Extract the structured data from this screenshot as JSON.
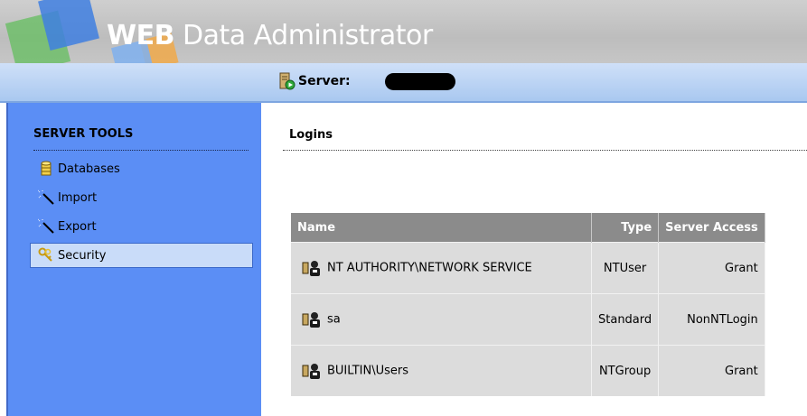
{
  "header": {
    "title_bold": "WEB",
    "title_rest": " Data Administrator"
  },
  "server_bar": {
    "label": "Server:",
    "value_redacted": true
  },
  "sidebar": {
    "heading": "SERVER TOOLS",
    "items": [
      {
        "label": "Databases",
        "icon": "database-icon",
        "selected": false
      },
      {
        "label": "Import",
        "icon": "wand-icon",
        "selected": false
      },
      {
        "label": "Export",
        "icon": "wand-icon",
        "selected": false
      },
      {
        "label": "Security",
        "icon": "keys-icon",
        "selected": true
      }
    ]
  },
  "content": {
    "heading": "Logins",
    "columns": [
      "Name",
      "Type",
      "Server Access"
    ],
    "rows": [
      {
        "name": "NT AUTHORITY\\NETWORK SERVICE",
        "type": "NTUser",
        "access": "Grant",
        "icon": "user-login-icon"
      },
      {
        "name": "sa",
        "type": "Standard",
        "access": "NonNTLogin",
        "icon": "user-login-icon"
      },
      {
        "name": "BUILTIN\\Users",
        "type": "NTGroup",
        "access": "Grant",
        "icon": "user-login-icon"
      }
    ]
  },
  "colors": {
    "sidebar_bg": "#5b8ef5",
    "sidebar_selected": "#c9dcf9",
    "server_bar": "#a9c8f0",
    "table_header": "#8b8b8b",
    "table_cell": "#dcdcdc"
  }
}
